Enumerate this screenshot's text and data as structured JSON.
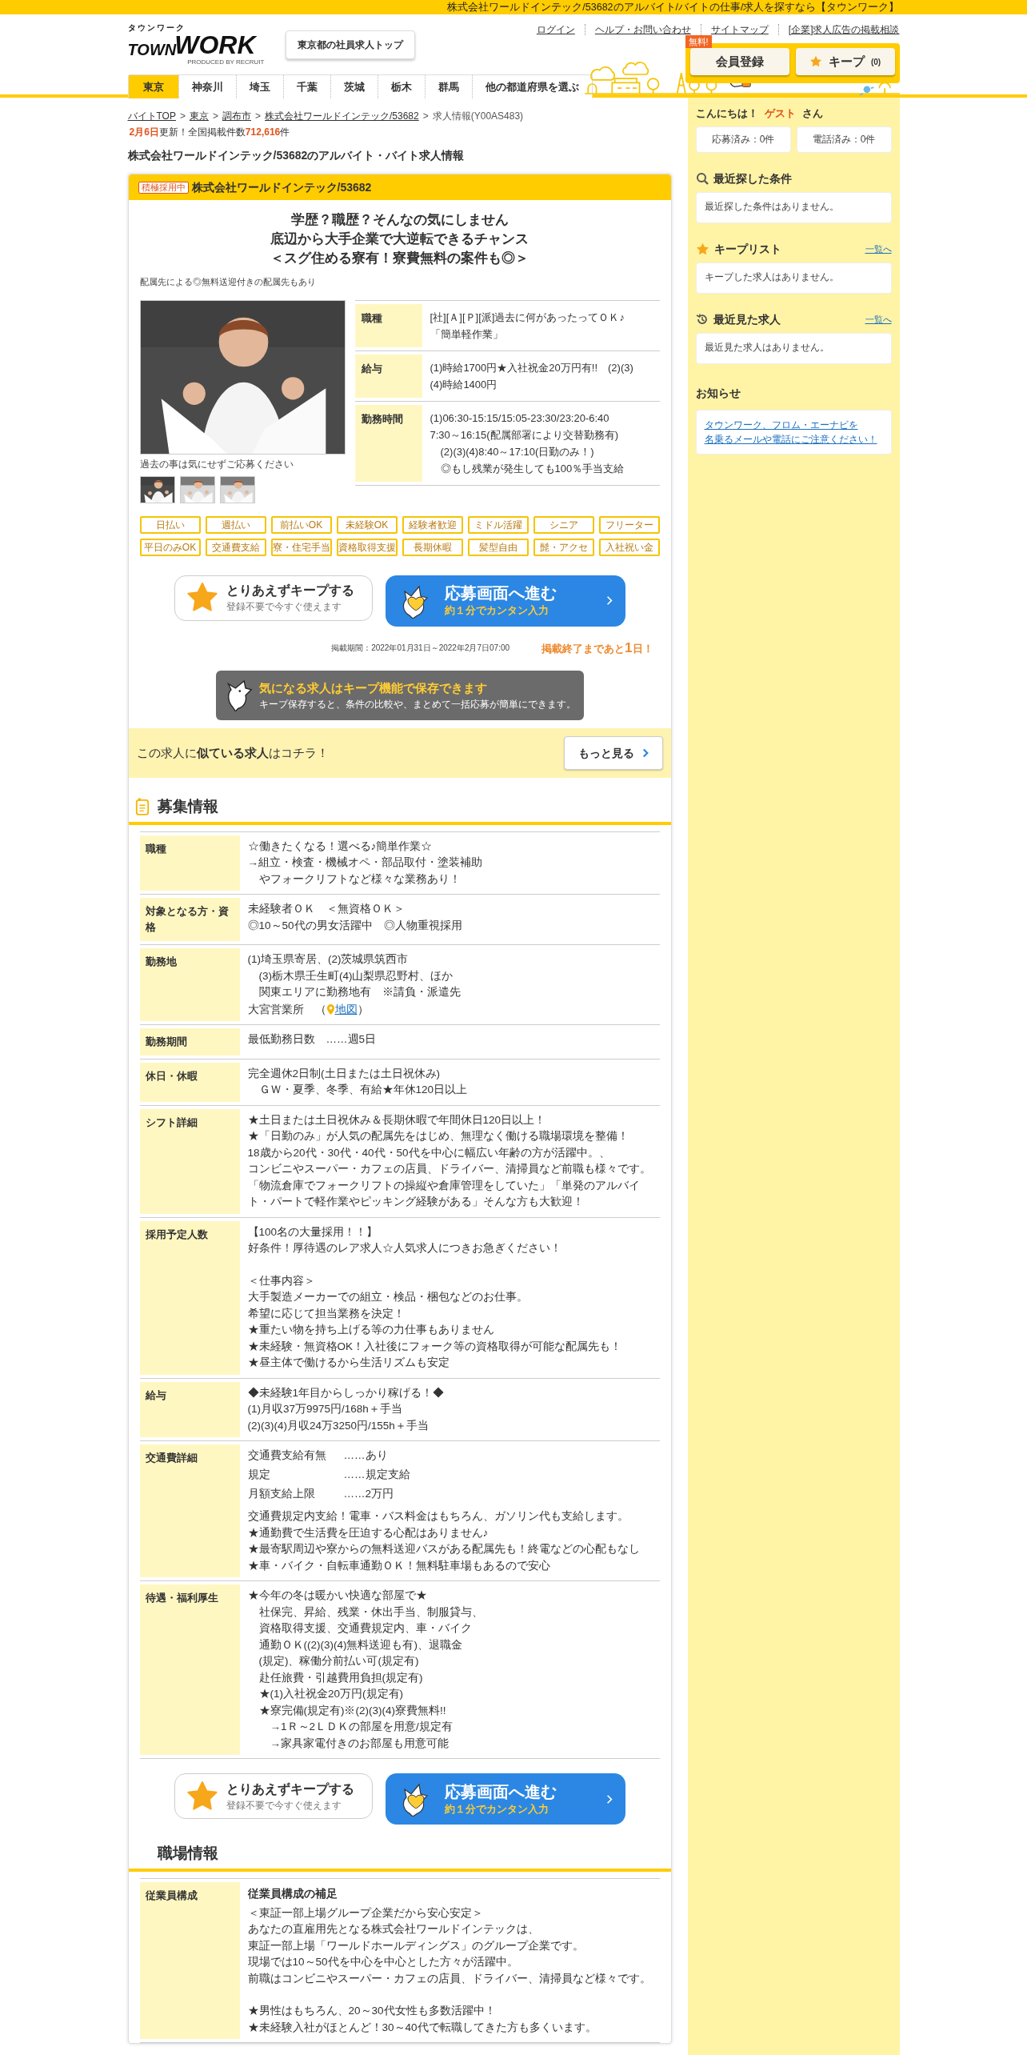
{
  "top_bar": {
    "text": "株式会社ワールドインテック/53682のアルバイト/バイトの仕事/求人を探すなら【タウンワーク】"
  },
  "header": {
    "logo": {
      "kana": "タウンワーク",
      "town": "TOWN",
      "work": "WORK",
      "producer": "PRODUCED BY RECRUIT"
    },
    "top_button": "東京都の社員求人トップ",
    "links": [
      "ログイン",
      "ヘルプ・お問い合わせ",
      "サイトマップ",
      "[企業]求人広告の掲載相談"
    ],
    "register": {
      "badge": "無料!",
      "label": "会員登録"
    },
    "keep": {
      "label": "キープ",
      "count": "(0)"
    }
  },
  "area_tabs": [
    {
      "label": "東京",
      "selected": true
    },
    {
      "label": "神奈川",
      "selected": false
    },
    {
      "label": "埼玉",
      "selected": false
    },
    {
      "label": "千葉",
      "selected": false
    },
    {
      "label": "茨城",
      "selected": false
    },
    {
      "label": "栃木",
      "selected": false
    },
    {
      "label": "群馬",
      "selected": false
    },
    {
      "label": "他の都道府県を選ぶ",
      "selected": false
    }
  ],
  "breadcrumb": {
    "items": [
      {
        "label": "バイトTOP",
        "separator": ">"
      },
      {
        "label": "東京",
        "separator": ">"
      },
      {
        "label": "調布市",
        "separator": ">"
      },
      {
        "label": "株式会社ワールドインテック/53682",
        "separator": ">"
      }
    ],
    "current": "求人情報(Y00AS483)",
    "update_date": "2月6日",
    "update_text": "更新！全国掲載件数",
    "count": "712,616",
    "count_unit": "件"
  },
  "page_title": "株式会社ワールドインテック/53682のアルバイト・バイト求人情報",
  "job": {
    "badge": "積極採用中",
    "company": "株式会社ワールドインテック/53682",
    "catch": [
      "学歴？職歴？そんなの気にしません",
      "底辺から大手企業で大逆転できるチャンス",
      "＜スグ住める寮有！寮費無料の案件も◎＞"
    ],
    "sub_catch": "配属先による◎無料送迎付きの配属先もあり",
    "photo": {
      "kind": "picture"
    },
    "photo_caption": "過去の事は気にせずご応募ください",
    "thumbnails": [
      {
        "kind": "picture"
      },
      {
        "kind": "picture"
      },
      {
        "kind": "picture"
      }
    ],
    "summary": [
      {
        "label": "職種",
        "lines": [
          "[社][Ａ][Ｐ][派]過去に何があったってＯＫ♪",
          "「簡単軽作業」"
        ]
      },
      {
        "label": "給与",
        "lines": [
          "(1)時給1700円★入社祝金20万円有!!　(2)(3)",
          "(4)時給1400円"
        ]
      },
      {
        "label": "勤務時間",
        "lines": [
          "(1)06:30-15:15/15:05-23:30/23:20-6:40",
          "7:30～16:15(配属部署により交替勤務有)",
          "　(2)(3)(4)8:40～17:10(日勤のみ！)",
          "　◎もし残業が発生しても100％手当支給"
        ]
      }
    ],
    "tags": [
      "日払い",
      "週払い",
      "前払いOK",
      "未経験OK",
      "経験者歓迎",
      "ミドル活躍",
      "シニア",
      "フリーター",
      "平日のみOK",
      "交通費支給",
      "寮・住宅手当",
      "資格取得支援",
      "長期休暇",
      "髪型自由",
      "髭・アクセ",
      "入社祝い金"
    ],
    "keep_button": {
      "title": "とりあえずキープする",
      "sub": "登録不要で今すぐ使えます"
    },
    "apply_button": {
      "title": "応募画面へ進む",
      "sub": "約１分でカンタン入力"
    },
    "period": "掲載期間：2022年01月31日～2022年2月7日07:00",
    "countdown": {
      "before": "掲載終了まであと",
      "number": "1",
      "after": "日！"
    },
    "keep_tip": {
      "title": "気になる求人はキープ機能で保存できます",
      "text": "キープ保存すると、条件の比較や、まとめて一括応募が簡単にできます。"
    },
    "similar": {
      "text": "この求人に**似ている求人**はコチラ！",
      "button": "もっと見る"
    }
  },
  "recruitment": {
    "title": "募集情報",
    "rows": [
      {
        "label": "職種",
        "kind": "text",
        "paragraphs": [
          [
            "☆働きたくなる！選べる♪簡単作業☆",
            "→組立・検査・機械オペ・部品取付・塗装補助",
            "　やフォークリフトなど様々な業務あり！"
          ]
        ]
      },
      {
        "label": "対象となる方・資格",
        "kind": "text",
        "paragraphs": [
          [
            "未経験者ＯＫ　＜無資格ＯＫ＞",
            "◎10～50代の男女活躍中　◎人物重視採用"
          ]
        ]
      },
      {
        "label": "勤務地",
        "kind": "location",
        "paragraphs": [
          [
            "(1)埼玉県寄居、(2)茨城県筑西市",
            "　(3)栃木県壬生町(4)山梨県忍野村、ほか",
            "　関東エリアに勤務地有　※請負・派遣先"
          ]
        ],
        "office": {
          "name": "大宮営業所　（",
          "link": "地図",
          "close": "）"
        }
      },
      {
        "label": "勤務期間",
        "kind": "text",
        "paragraphs": [
          [
            "最低勤務日数　……週5日"
          ]
        ]
      },
      {
        "label": "休日・休暇",
        "kind": "text",
        "paragraphs": [
          [
            "完全週休2日制(土日または土日祝休み)",
            "　ＧＷ・夏季、冬季、有給★年休120日以上"
          ]
        ]
      },
      {
        "label": "シフト詳細",
        "kind": "text",
        "paragraphs": [
          [
            "★土日または土日祝休み＆長期休暇で年間休日120日以上！",
            "★「日勤のみ」が人気の配属先をはじめ、無理なく働ける職場環境を整備！",
            "18歳から20代・30代・40代・50代を中心に幅広い年齢の方が活躍中。、",
            "コンビニやスーパー・カフェの店員、ドライバー、清掃員など前職も様々です。",
            "「物流倉庫でフォークリフトの操縦や倉庫管理をしていた」「単発のアルバイ",
            "ト・パートで軽作業やピッキング経験がある」そんな方も大歓迎！"
          ]
        ]
      },
      {
        "label": "採用予定人数",
        "kind": "text",
        "paragraphs": [
          [
            "【100名の大量採用！！】",
            "好条件！厚待遇のレア求人☆人気求人につきお急ぎください！"
          ],
          [
            "＜仕事内容＞",
            "大手製造メーカーでの組立・検品・梱包などのお仕事。",
            "希望に応じて担当業務を決定！",
            "★重たい物を持ち上げる等の力仕事もありません",
            "★未経験・無資格OK！入社後にフォーク等の資格取得が可能な配属先も！",
            "★昼主体で働けるから生活リズムも安定"
          ]
        ]
      },
      {
        "label": "給与",
        "kind": "text",
        "paragraphs": [
          [
            "◆未経験1年目からしっかり稼げる！◆",
            "(1)月収37万9975円/168h＋手当",
            "(2)(3)(4)月収24万3250円/155h＋手当"
          ]
        ]
      },
      {
        "label": "交通費詳細",
        "kind": "transport",
        "pairs": [
          {
            "key": "交通費支給有無",
            "value": "……あり"
          },
          {
            "key": "規定",
            "value": "……規定支給"
          },
          {
            "key": "月額支給上限",
            "value": "……2万円"
          }
        ],
        "paragraphs": [
          [
            "交通費規定内支給！電車・バス料金はもちろん、ガソリン代も支給します。",
            "★通勤費で生活費を圧迫する心配はありません♪",
            "★最寄駅周辺や寮からの無料送迎バスがある配属先も！終電などの心配もなし",
            "★車・バイク・自転車通勤ＯＫ！無料駐車場もあるので安心"
          ]
        ]
      },
      {
        "label": "待遇・福利厚生",
        "kind": "text",
        "paragraphs": [
          [
            "★今年の冬は暖かい快適な部屋で★",
            "　社保完、昇給、残業・休出手当、制服貸与、",
            "　資格取得支援、交通費規定内、車・バイク",
            "　通勤ＯＫ((2)(3)(4)無料送迎も有)、退職金",
            "　(規定)、稼働分前払い可(規定有)",
            "　赴任旅費・引越費用負担(規定有)",
            "　★(1)入社祝金20万円(規定有)",
            "　★寮完備(規定有)※(2)(3)(4)寮費無料!!",
            "　　→1Ｒ～2ＬＤＫの部屋を用意/規定有",
            "　　→家具家電付きのお部屋も用意可能"
          ]
        ]
      }
    ]
  },
  "bottom_buttons": {
    "keep": {
      "title": "とりあえずキープする",
      "sub": "登録不要で今すぐ使えます"
    },
    "apply": {
      "title": "応募画面へ進む",
      "sub": "約１分でカンタン入力"
    }
  },
  "workplace": {
    "title": "職場情報",
    "rows": [
      {
        "label": "従業員構成",
        "subtitle": "従業員構成の補足",
        "paragraphs": [
          [
            "＜東証一部上場グループ企業だから安心安定＞",
            "あなたの直雇用先となる株式会社ワールドインテックは、",
            "東証一部上場「ワールドホールディングス」のグループ企業です。",
            "現場では10～50代を中心を中心とした方々が活躍中。",
            "前職はコンビニやスーパー・カフェの店員、ドライバー、清掃員など様々です。"
          ],
          [
            "★男性はもちろん、20～30代女性も多数活躍中！",
            "★未経験入社がほとんど！30～40代で転職してきた方も多くいます。"
          ]
        ]
      }
    ]
  },
  "sidebar": {
    "greeting": {
      "hello": "こんにちは！",
      "name": "ゲスト",
      "suffix": "さん"
    },
    "counters": [
      "応募済み：0件",
      "電話済み：0件"
    ],
    "sections": [
      {
        "kind": "search",
        "title": "最近探した条件",
        "message": "最近探した条件はありません。"
      },
      {
        "kind": "keep",
        "title": "キープリスト",
        "link": "一覧へ",
        "message": "キープした求人はありません。"
      },
      {
        "kind": "history",
        "title": "最近見た求人",
        "link": "一覧へ",
        "message": "最近見た求人はありません。"
      }
    ],
    "notice": {
      "title": "お知らせ",
      "link_lines": [
        "タウンワーク、フロム・エーナビを",
        "名乗るメールや電話にご注意ください！"
      ]
    }
  }
}
